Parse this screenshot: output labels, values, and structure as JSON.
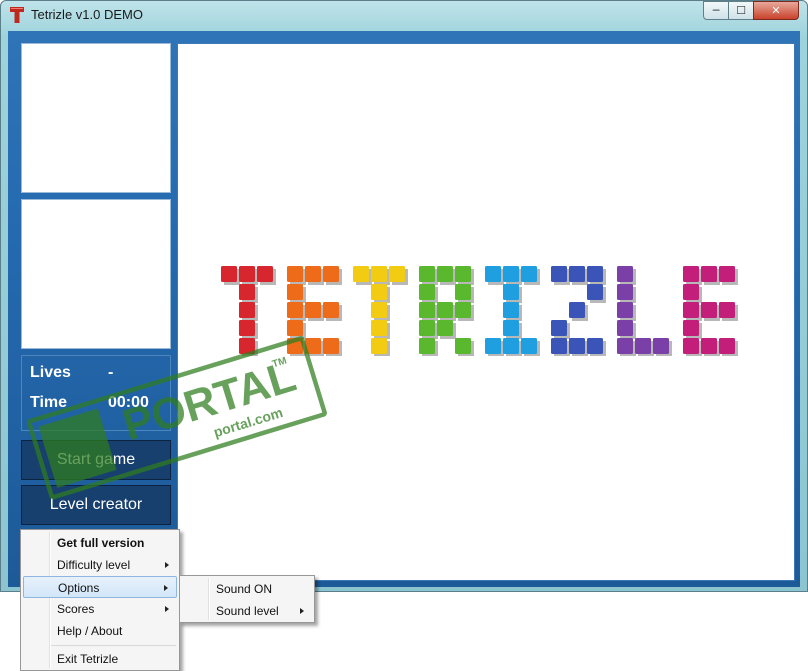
{
  "window": {
    "title": "Tetrizle v1.0 DEMO",
    "minimize": "─",
    "maximize": "☐",
    "close": "✕"
  },
  "stats": {
    "lives_label": "Lives",
    "lives_value": "-",
    "time_label": "Time",
    "time_value": "00:00"
  },
  "buttons": {
    "start_game": "Start game",
    "level_creator": "Level creator"
  },
  "logo": {
    "text": "TETRIZLE"
  },
  "watermark": {
    "brand": "PORTAL",
    "tm": "TM",
    "url": "portal.com"
  },
  "context_menu": {
    "items": [
      {
        "label": "Get full version",
        "bold": true
      },
      {
        "label": "Difficulty level",
        "submenu": true
      },
      {
        "label": "Options",
        "submenu": true,
        "highlighted": true
      },
      {
        "label": "Scores",
        "submenu": true
      },
      {
        "label": "Help / About"
      },
      {
        "label": "Exit Tetrizle"
      }
    ]
  },
  "options_submenu": {
    "items": [
      {
        "label": "Sound ON"
      },
      {
        "label": "Sound level",
        "submenu": true
      }
    ]
  },
  "colors": {
    "client_bg": "#2469ae",
    "button_bg": "#18406e",
    "menu_highlight": "#d3e6f8",
    "stamp_green": "#2f7d1e"
  }
}
